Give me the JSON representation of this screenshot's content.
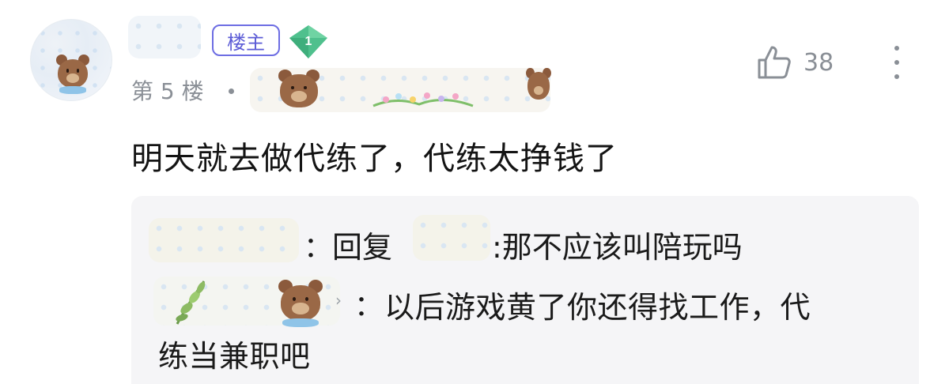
{
  "comment": {
    "badge_label": "楼主",
    "level": "1",
    "floor": "第 5 楼",
    "like_count": "38",
    "text": "明天就去做代练了，代练太挣钱了"
  },
  "replies": [
    {
      "reply_word": "回复",
      "text": ":那不应该叫陪玩吗"
    },
    {
      "text_line1": "以后游戏黄了你还得找工作，代",
      "text_line2": "练当兼职吧"
    }
  ],
  "icons": {
    "like": "thumbs-up-icon",
    "more": "more-vertical-icon",
    "level": "diamond-level-icon"
  },
  "colors": {
    "badge": "#5b5bd6",
    "level_badge": "#4fc08d",
    "meta_text": "#8a8f96",
    "reply_bg": "#f5f5f7"
  }
}
